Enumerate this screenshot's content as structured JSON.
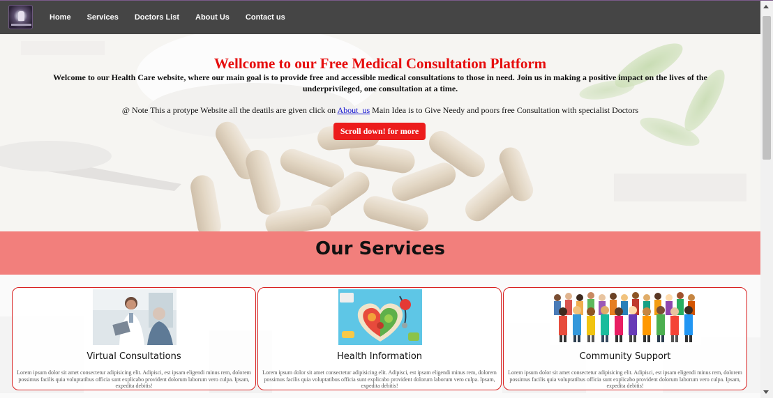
{
  "nav": {
    "logo_icon": "health-logo",
    "links": [
      "Home",
      "Services",
      "Doctors List",
      "About Us",
      "Contact us"
    ]
  },
  "hero": {
    "title": "Wellcome to our Free Medical Consultation Platform",
    "description": "Welcome to our Health Care website, where our main goal is to provide free and accessible medical consultations to those in need. Join us in making a positive impact on the lives of the underprivileged, one consultation at a time.",
    "note_prefix": "@ Note This a protype Website all the deatils are given click on ",
    "note_link": "About_us",
    "note_suffix": " Main Idea is to Give Needy and poors free Consultation with specialist Doctors",
    "button_label": "Scroll down! for more"
  },
  "services": {
    "heading": "Our Services",
    "cards": [
      {
        "title": "Virtual Consultations",
        "text": "Lorem ipsum dolor sit amet consectetur adipisicing elit. Adipisci, est ipsam eligendi minus rem, dolorem possimus facilis quia voluptatibus officia sunt explicabo provident dolorum laborum vero culpa. Ipsam, expedita debitis!",
        "image_icon": "doctor-patient-photo"
      },
      {
        "title": "Health Information",
        "text": "Lorem ipsum dolor sit amet consectetur adipisicing elit. Adipisci, est ipsam eligendi minus rem, dolorem possimus facilis quia voluptatibus officia sunt explicabo provident dolorum laborum vero culpa. Ipsam, expedita debitis!",
        "image_icon": "healthy-food-heart-photo"
      },
      {
        "title": "Community Support",
        "text": "Lorem ipsum dolor sit amet consectetur adipisicing elit. Adipisci, est ipsam eligendi minus rem, dolorem possimus facilis quia voluptatibus officia sunt explicabo provident dolorum laborum vero culpa. Ipsam, expedita debitis!",
        "image_icon": "crowd-of-people-illustration"
      }
    ]
  },
  "colors": {
    "navbar": "#454545",
    "title_red": "#e60d0d",
    "button_red": "#ec1c1c",
    "services_bar": "#f27f7c",
    "card_border": "#d82020",
    "link_blue": "#1010d0"
  }
}
